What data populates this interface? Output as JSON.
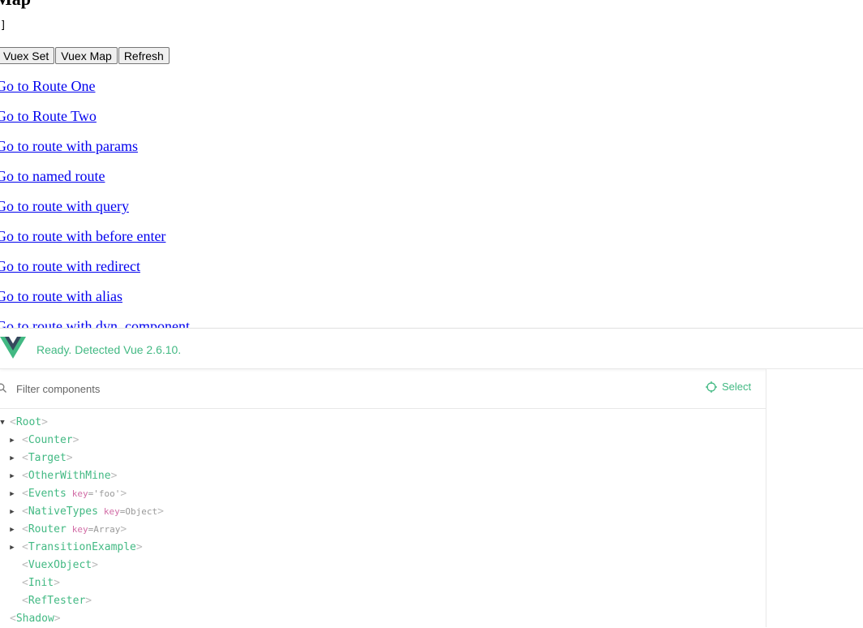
{
  "page": {
    "title": "Map",
    "code_text": "]",
    "buttons": [
      "Vuex Set",
      "Vuex Map",
      "Refresh"
    ],
    "links": [
      "Go to Route One",
      "Go to Route Two",
      "Go to route with params",
      "Go to named route",
      "Go to route with query",
      "Go to route with before enter",
      "Go to route with redirect",
      "Go to route with alias",
      "Go to route with dyn. component"
    ]
  },
  "devtools": {
    "status": "Ready. Detected Vue 2.6.10.",
    "filter_placeholder": "Filter components",
    "select_label": "Select",
    "tree": [
      {
        "name": "Root",
        "arrow": "down"
      },
      {
        "name": "Counter",
        "arrow": "right"
      },
      {
        "name": "Target",
        "arrow": "right"
      },
      {
        "name": "OtherWithMine",
        "arrow": "right"
      },
      {
        "name": "Events",
        "arrow": "right",
        "key_label": "key",
        "key_value": "='foo'"
      },
      {
        "name": "NativeTypes",
        "arrow": "right",
        "key_label": "key",
        "key_value": "=Object"
      },
      {
        "name": "Router",
        "arrow": "right",
        "key_label": "key",
        "key_value": "=Array"
      },
      {
        "name": "TransitionExample",
        "arrow": "right"
      },
      {
        "name": "VuexObject",
        "arrow": "none"
      },
      {
        "name": "Init",
        "arrow": "none"
      },
      {
        "name": "RefTester",
        "arrow": "none"
      },
      {
        "name": "Shadow",
        "arrow": "none"
      }
    ]
  },
  "colors": {
    "vue_green": "#42b983",
    "link_blue": "#0000ee",
    "bracket_gray": "#bbbbbb",
    "key_pink": "#d16ba5"
  }
}
